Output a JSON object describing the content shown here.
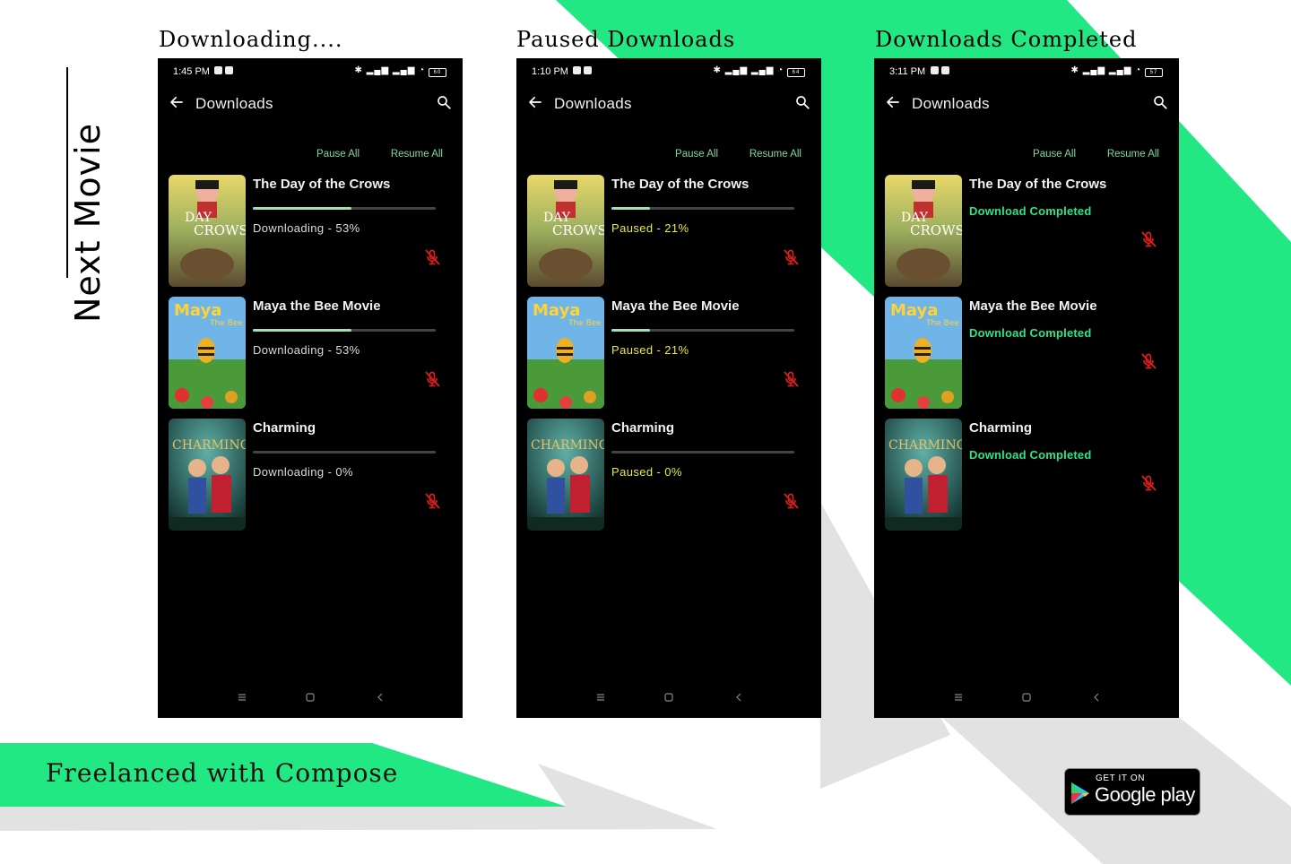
{
  "app_title": "Next Movie",
  "footer_title": "Freelanced with Compose",
  "colors": {
    "accent_green": "#21e883",
    "light_gray": "#e3e2e3",
    "progress_fill": "#9fe2b0",
    "action_text": "#7fd6a0",
    "downloading_text": "#dcdcdc",
    "paused_text": "#e9e94a",
    "completed_text": "#2de58a",
    "mute_icon": "#e01e1e"
  },
  "store_badge": {
    "small_text": "GET IT ON",
    "big_text": "Google play",
    "icon": "play-triangle-icon"
  },
  "sections": [
    {
      "heading": "Downloading....",
      "status_time": "1:45 PM",
      "battery": "60",
      "toolbar_title": "Downloads",
      "pause_all": "Pause All",
      "resume_all": "Resume All",
      "status_color": "downloading",
      "items": [
        {
          "title": "The Day of the Crows",
          "status": "Downloading - 53%",
          "progress": 0.54,
          "completed": false
        },
        {
          "title": "Maya the Bee Movie",
          "status": "Downloading - 53%",
          "progress": 0.54,
          "completed": false
        },
        {
          "title": "Charming",
          "status": "Downloading - 0%",
          "progress": 0.0,
          "completed": false
        }
      ]
    },
    {
      "heading": "Paused Downloads",
      "status_time": "1:10 PM",
      "battery": "64",
      "toolbar_title": "Downloads",
      "pause_all": "Pause All",
      "resume_all": "Resume All",
      "status_color": "paused",
      "items": [
        {
          "title": "The Day of the Crows",
          "status": "Paused - 21%",
          "progress": 0.21,
          "completed": false
        },
        {
          "title": "Maya the Bee Movie",
          "status": "Paused - 21%",
          "progress": 0.21,
          "completed": false
        },
        {
          "title": "Charming",
          "status": "Paused - 0%",
          "progress": 0.0,
          "completed": false
        }
      ]
    },
    {
      "heading": "Downloads Completed",
      "status_time": "3:11 PM",
      "battery": "57",
      "toolbar_title": "Downloads",
      "pause_all": "Pause All",
      "resume_all": "Resume All",
      "status_color": "completed",
      "items": [
        {
          "title": "The Day of the Crows",
          "status": "Download Completed",
          "progress": 1.0,
          "completed": true
        },
        {
          "title": "Maya the Bee Movie",
          "status": "Download Completed",
          "progress": 1.0,
          "completed": true
        },
        {
          "title": "Charming",
          "status": "Download Completed",
          "progress": 1.0,
          "completed": true
        }
      ]
    }
  ]
}
